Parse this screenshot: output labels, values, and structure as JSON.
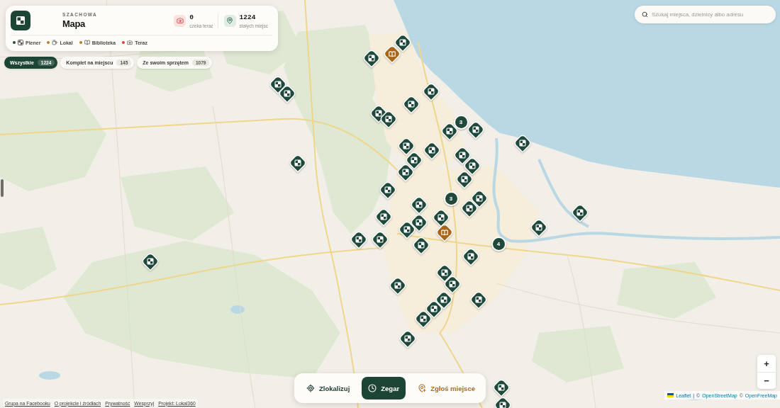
{
  "header": {
    "kicker": "SZACHOWA",
    "title": "Mapa",
    "stats": [
      {
        "kind": "waiting",
        "value": "0",
        "label": "czeka teraz"
      },
      {
        "kind": "permanent",
        "value": "1224",
        "label": "stałych miejsc"
      }
    ],
    "legend": [
      {
        "kind": "plener",
        "label": "Plener",
        "color": "#1f4d3b"
      },
      {
        "kind": "lokal",
        "label": "Lokal",
        "color": "#c07a25"
      },
      {
        "kind": "biblioteka",
        "label": "Biblioteka",
        "color": "#c07a25"
      },
      {
        "kind": "teraz",
        "label": "Teraz",
        "color": "#d8453b"
      }
    ]
  },
  "filters": [
    {
      "label": "Wszystkie",
      "count": "1224",
      "selected": true
    },
    {
      "label": "Komplet na miejscu",
      "count": "145",
      "selected": false
    },
    {
      "label": "Ze swoim sprzętem",
      "count": "1079",
      "selected": false
    }
  ],
  "search": {
    "placeholder": "Szukaj miejsca, dzielnicy albo adresu"
  },
  "markers": [
    {
      "kind": "plener"
    },
    {
      "kind": "biblioteka"
    },
    {
      "kind": "plener"
    },
    {
      "kind": "plener"
    },
    {
      "kind": "plener"
    },
    {
      "kind": "plener"
    },
    {
      "kind": "plener"
    },
    {
      "kind": "plener"
    },
    {
      "kind": "plener"
    },
    {
      "kind": "cluster",
      "count": "3"
    },
    {
      "kind": "plener"
    },
    {
      "kind": "plener"
    },
    {
      "kind": "plener"
    },
    {
      "kind": "plener"
    },
    {
      "kind": "plener"
    },
    {
      "kind": "plener"
    },
    {
      "kind": "plener"
    },
    {
      "kind": "plener"
    },
    {
      "kind": "plener"
    },
    {
      "kind": "plener"
    },
    {
      "kind": "plener"
    },
    {
      "kind": "plener"
    },
    {
      "kind": "cluster",
      "count": "3"
    },
    {
      "kind": "plener"
    },
    {
      "kind": "plener"
    },
    {
      "kind": "plener"
    },
    {
      "kind": "plener"
    },
    {
      "kind": "plener"
    },
    {
      "kind": "plener"
    },
    {
      "kind": "plener"
    },
    {
      "kind": "plener"
    },
    {
      "kind": "plener"
    },
    {
      "kind": "biblioteka"
    },
    {
      "kind": "plener"
    },
    {
      "kind": "plener"
    },
    {
      "kind": "cluster",
      "count": "4"
    },
    {
      "kind": "plener"
    },
    {
      "kind": "plener"
    },
    {
      "kind": "plener"
    },
    {
      "kind": "plener"
    },
    {
      "kind": "plener"
    },
    {
      "kind": "plener"
    },
    {
      "kind": "plener"
    },
    {
      "kind": "plener"
    },
    {
      "kind": "plener"
    },
    {
      "kind": "plener"
    },
    {
      "kind": "plener"
    },
    {
      "kind": "plener"
    },
    {
      "kind": "plener"
    }
  ],
  "zoom": {
    "in": "+",
    "out": "−"
  },
  "attribution": [
    {
      "kind": "link",
      "text": "Leaflet"
    },
    {
      "kind": "text",
      "text": "|"
    },
    {
      "kind": "text",
      "text": "©"
    },
    {
      "kind": "link",
      "text": "OpenStreetMap"
    },
    {
      "kind": "text",
      "text": "©"
    },
    {
      "kind": "link",
      "text": "OpenFreeMap"
    }
  ],
  "actions": [
    {
      "kind": "locate",
      "label": "Zlokalizuj",
      "selected": false
    },
    {
      "kind": "clock",
      "label": "Zegar",
      "selected": true
    },
    {
      "kind": "report",
      "label": "Zgłoś miejsce",
      "selected": false
    }
  ],
  "footer_links": [
    "Grupa na Facebooku",
    "O projekcie i źródłach",
    "Prywatność",
    "Wesprzyj",
    "Projekt: Lokal360"
  ]
}
